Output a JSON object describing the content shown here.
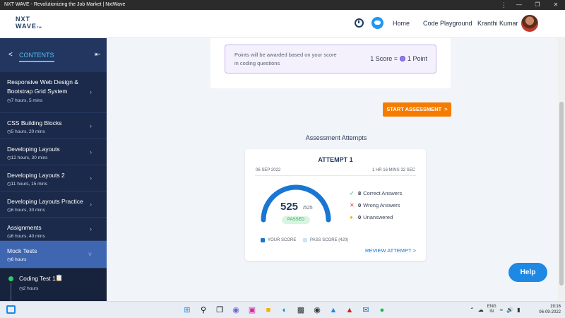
{
  "window": {
    "title": "NXT WAVE - Revolutionizing the Job Market | NxtWave",
    "menu_dots": "⋮",
    "minimize": "—",
    "maximize": "❐",
    "close": "✕"
  },
  "header": {
    "logo_line1": "NXT",
    "logo_line2": "WAVE",
    "logo_tm": "TM",
    "nav_home": "Home",
    "nav_code_playground": "Code Playground",
    "user_name": "Kranthi Kumar"
  },
  "sidebar": {
    "back_glyph": "<",
    "contents_label": "CONTENTS",
    "collapse_glyph": "⇤",
    "courses": [
      {
        "title": "Responsive Web Design & Bootstrap Grid System",
        "duration": "7 hours, 5 mins"
      },
      {
        "title": "CSS Building Blocks",
        "duration": "5 hours, 20 mins"
      },
      {
        "title": "Developing Layouts",
        "duration": "12 hours, 30 mins"
      },
      {
        "title": "Developing Layouts 2",
        "duration": "11 hours, 15 mins"
      },
      {
        "title": "Developing Layouts Practice",
        "duration": "6 hours, 30 mins"
      },
      {
        "title": "Assignments",
        "duration": "6 hours, 40 mins"
      },
      {
        "title": "Mock Tests",
        "duration": "6 hours"
      }
    ],
    "active_course_index": 6,
    "sub_item": {
      "title": "Coding Test 1",
      "duration": "2 hours"
    }
  },
  "info": {
    "points_text": "Points will be awarded based on your score in coding questions",
    "score_left": "1 Score =",
    "score_right": "1 Point"
  },
  "start_button": {
    "label": "START ASSESSMENT",
    "arrow": ">"
  },
  "attempts": {
    "heading": "Assessment Attempts",
    "attempt": {
      "title": "ATTEMPT 1",
      "date": "06 SEP 2022",
      "time_taken": "1 HR 16 MINS 32 SEC",
      "score": 525,
      "score_display": "525",
      "total_display": "/525",
      "pass_score": 420,
      "status": "PASSED",
      "correct_count": "8",
      "correct_label": "Correct Answers",
      "wrong_count": "0",
      "wrong_label": "Wrong Answers",
      "unanswered_count": "0",
      "unanswered_label": "Unanswered",
      "legend_yours": "YOUR SCORE",
      "legend_pass": "PASS SCORE (420)",
      "review_link": "REVIEW ATTEMPT",
      "review_arrow": ">"
    }
  },
  "help_button": {
    "label": "Help"
  },
  "taskbar": {
    "lang_line1": "ENG",
    "lang_line2": "IN",
    "time": "19:16",
    "date": "06-09-2022"
  },
  "colors": {
    "accent": "#1976d2",
    "orange": "#f57c00",
    "sidebar_bg": "#1b2a4a",
    "active_item": "#3f66b1",
    "passed_green": "#2e9e55"
  }
}
